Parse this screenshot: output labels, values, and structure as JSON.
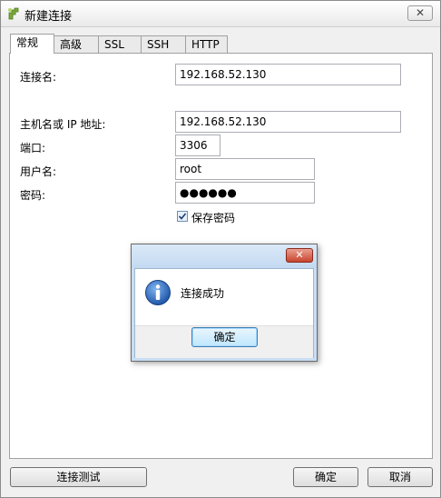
{
  "window": {
    "title": "新建连接",
    "close_glyph": "✕"
  },
  "tabs": [
    {
      "label": "常规",
      "active": true
    },
    {
      "label": "高级"
    },
    {
      "label": "SSL"
    },
    {
      "label": "SSH"
    },
    {
      "label": "HTTP"
    }
  ],
  "form": {
    "connection_name_label": "连接名:",
    "connection_name_value": "192.168.52.130",
    "host_label": "主机名或 IP 地址:",
    "host_value": "192.168.52.130",
    "port_label": "端口:",
    "port_value": "3306",
    "user_label": "用户名:",
    "user_value": "root",
    "password_label": "密码:",
    "password_value": "●●●●●●",
    "save_password_label": "保存密码",
    "save_password_checked": true
  },
  "dialog": {
    "message": "连接成功",
    "ok_label": "确定",
    "close_glyph": "✕",
    "icon": "info-icon"
  },
  "footer": {
    "test_label": "连接测试",
    "ok_label": "确定",
    "cancel_label": "取消"
  },
  "colors": {
    "accent": "#3c7fb1",
    "dialog_close": "#c9442d",
    "info_icon": "#2a63b8"
  }
}
